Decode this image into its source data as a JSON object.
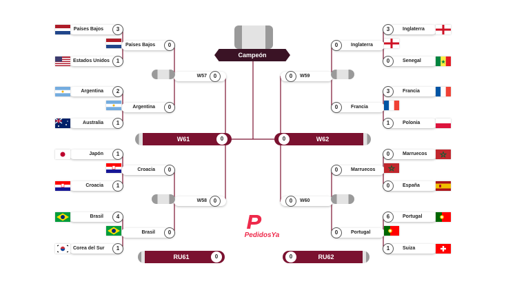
{
  "header": {
    "champion_label": "Campeón",
    "trophy_icon": "trophy-placeholder-icon"
  },
  "colors": {
    "maroon": "#7b1230",
    "line": "#7b1230",
    "brand": "#ee2a4b"
  },
  "left": {
    "r16": [
      {
        "team": "Países Bajos",
        "score": "3",
        "flag": "nl-flag-icon"
      },
      {
        "team": "Estados Unidos",
        "score": "1",
        "flag": "us-flag-icon"
      },
      {
        "team": "Argentina",
        "score": "2",
        "flag": "ar-flag-icon"
      },
      {
        "team": "Australia",
        "score": "1",
        "flag": "au-flag-icon"
      },
      {
        "team": "Japón",
        "score": "1",
        "flag": "jp-flag-icon"
      },
      {
        "team": "Croacia",
        "score": "1",
        "flag": "hr-flag-icon"
      },
      {
        "team": "Brasil",
        "score": "4",
        "flag": "br-flag-icon"
      },
      {
        "team": "Corea del Sur",
        "score": "1",
        "flag": "kr-flag-icon"
      }
    ],
    "qf": [
      {
        "team": "Países Bajos",
        "score": "0",
        "flag": "nl-flag-icon"
      },
      {
        "team": "Argentina",
        "score": "0",
        "flag": "ar-flag-icon"
      },
      {
        "team": "Croacia",
        "score": "0",
        "flag": "hr-flag-icon"
      },
      {
        "team": "Brasil",
        "score": "0",
        "flag": "br-flag-icon"
      }
    ],
    "sf": [
      {
        "label": "W57",
        "score": "0"
      },
      {
        "label": "W58",
        "score": "0"
      }
    ],
    "final": {
      "label": "W61",
      "score": "0"
    },
    "third": {
      "label": "RU61",
      "score": "0"
    }
  },
  "right": {
    "r16": [
      {
        "team": "Inglaterra",
        "score": "3",
        "flag": "en-flag-icon"
      },
      {
        "team": "Senegal",
        "score": "0",
        "flag": "sn-flag-icon"
      },
      {
        "team": "Francia",
        "score": "3",
        "flag": "fr-flag-icon"
      },
      {
        "team": "Polonia",
        "score": "1",
        "flag": "pl-flag-icon"
      },
      {
        "team": "Marruecos",
        "score": "0",
        "flag": "ma-flag-icon"
      },
      {
        "team": "España",
        "score": "0",
        "flag": "es-flag-icon"
      },
      {
        "team": "Portugal",
        "score": "6",
        "flag": "pt-flag-icon"
      },
      {
        "team": "Suiza",
        "score": "1",
        "flag": "ch-flag-icon"
      }
    ],
    "qf": [
      {
        "team": "Inglaterra",
        "score": "0",
        "flag": "en-flag-icon"
      },
      {
        "team": "Francia",
        "score": "0",
        "flag": "fr-flag-icon"
      },
      {
        "team": "Marruecos",
        "score": "0",
        "flag": "ma-flag-icon"
      },
      {
        "team": "Portugal",
        "score": "0",
        "flag": "pt-flag-icon"
      }
    ],
    "sf": [
      {
        "label": "W59",
        "score": "0"
      },
      {
        "label": "W60",
        "score": "0"
      }
    ],
    "final": {
      "label": "W62",
      "score": "0"
    },
    "third": {
      "label": "RU62",
      "score": "0"
    }
  },
  "brand": {
    "name": "PedidosYa",
    "logo_icon": "pedidosya-logo-icon"
  }
}
